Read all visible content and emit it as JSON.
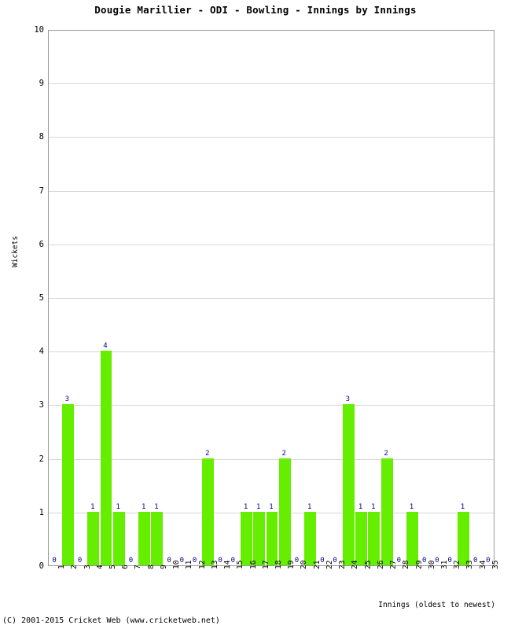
{
  "chart_data": {
    "type": "bar",
    "title": "Dougie Marillier - ODI - Bowling - Innings by Innings",
    "xlabel": "Innings (oldest to newest)",
    "ylabel": "Wickets",
    "ylim": [
      0,
      10
    ],
    "yticks": [
      0,
      1,
      2,
      3,
      4,
      5,
      6,
      7,
      8,
      9,
      10
    ],
    "grid": true,
    "legend": false,
    "bar_color": "#66ee00",
    "label_color": "#00008b",
    "categories": [
      "1",
      "2",
      "3",
      "4",
      "5",
      "6",
      "7",
      "8",
      "9",
      "10",
      "11",
      "12",
      "13",
      "14",
      "15",
      "16",
      "17",
      "18",
      "19",
      "20",
      "21",
      "22",
      "23",
      "24",
      "25",
      "26",
      "27",
      "28",
      "29",
      "30",
      "31",
      "32",
      "33",
      "34",
      "35"
    ],
    "values": [
      0,
      3,
      0,
      1,
      4,
      1,
      0,
      1,
      1,
      0,
      0,
      0,
      2,
      0,
      0,
      1,
      1,
      1,
      2,
      0,
      1,
      0,
      0,
      3,
      1,
      1,
      2,
      0,
      1,
      0,
      0,
      0,
      1,
      0,
      0
    ]
  },
  "footer": {
    "copyright": "(C) 2001-2015 Cricket Web (www.cricketweb.net)"
  }
}
